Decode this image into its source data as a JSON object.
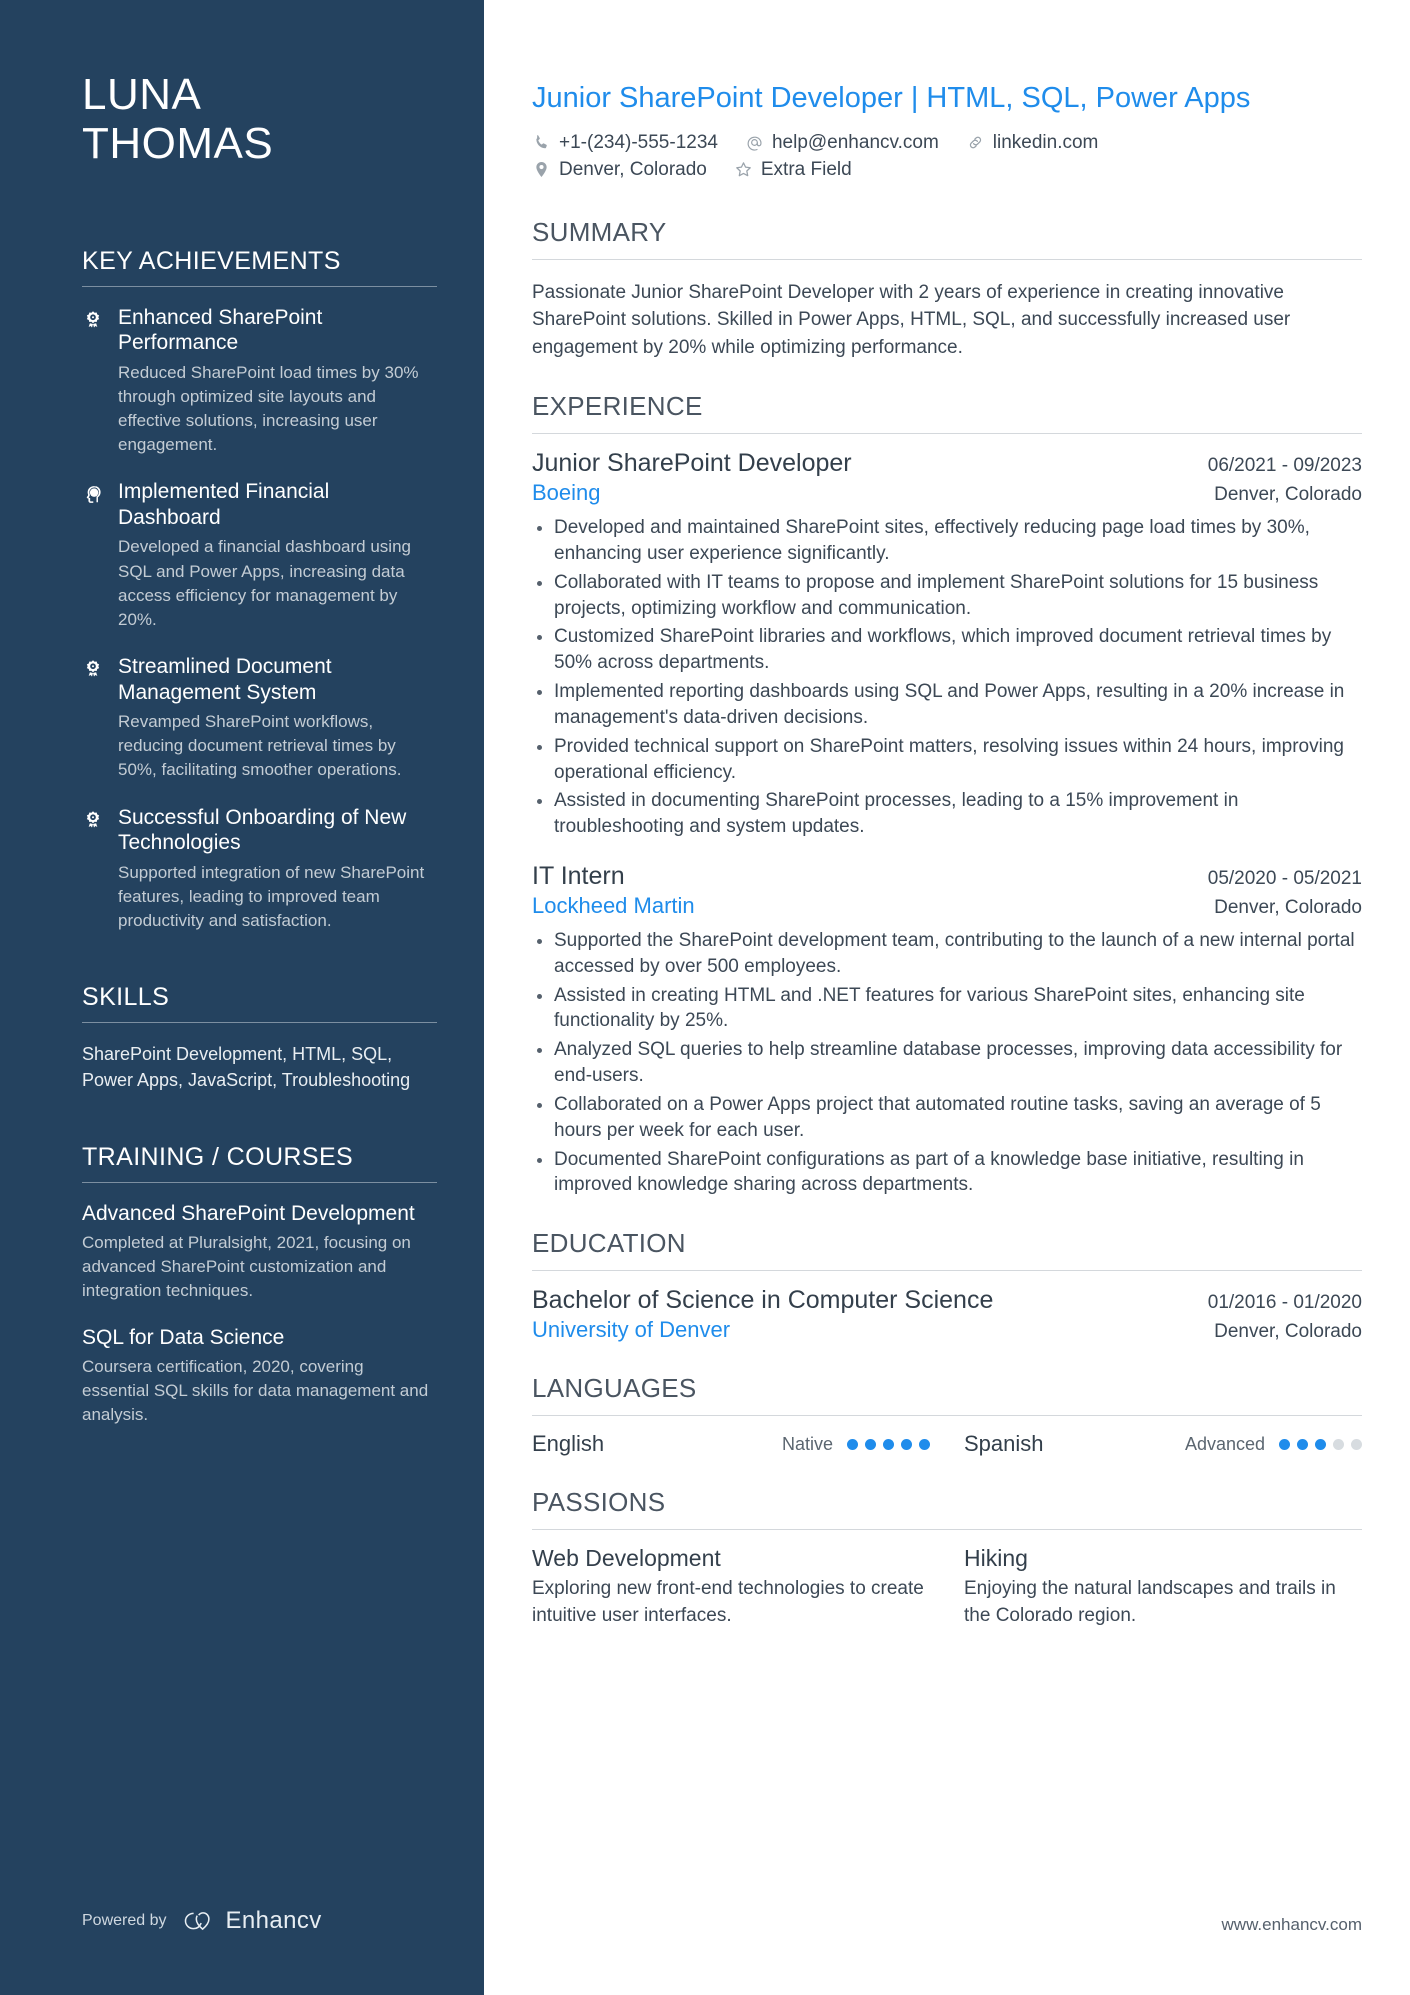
{
  "colors": {
    "sidebar_bg": "#24425f",
    "accent_blue": "#1f8ceb",
    "body_text": "#3c4855"
  },
  "sidebar": {
    "name_first": "LUNA",
    "name_last": "THOMAS",
    "achievements_heading": "KEY ACHIEVEMENTS",
    "achievements": [
      {
        "icon": "award-ribbon-icon",
        "title": "Enhanced SharePoint Performance",
        "desc": "Reduced SharePoint load times by 30% through optimized site layouts and effective solutions, increasing user engagement."
      },
      {
        "icon": "idea-head-icon",
        "title": "Implemented Financial Dashboard",
        "desc": "Developed a financial dashboard using SQL and Power Apps, increasing data access efficiency for management by 20%."
      },
      {
        "icon": "award-ribbon-icon",
        "title": "Streamlined Document Management System",
        "desc": "Revamped SharePoint workflows, reducing document retrieval times by 50%, facilitating smoother operations."
      },
      {
        "icon": "award-ribbon-icon",
        "title": "Successful Onboarding of New Technologies",
        "desc": "Supported integration of new SharePoint features, leading to improved team productivity and satisfaction."
      }
    ],
    "skills_heading": "SKILLS",
    "skills_text": "SharePoint Development, HTML, SQL, Power Apps, JavaScript, Troubleshooting",
    "training_heading": "TRAINING / COURSES",
    "courses": [
      {
        "title": "Advanced SharePoint Development",
        "desc": "Completed at Pluralsight, 2021, focusing on advanced SharePoint customization and integration techniques."
      },
      {
        "title": "SQL for Data Science",
        "desc": "Coursera certification, 2020, covering essential SQL skills for data management and analysis."
      }
    ],
    "powered_by_label": "Powered by",
    "brand_name": "Enhancv"
  },
  "main": {
    "headline": "Junior SharePoint Developer | HTML, SQL, Power Apps",
    "contacts": [
      {
        "icon": "phone-icon",
        "text": "+1-(234)-555-1234"
      },
      {
        "icon": "email-at-icon",
        "text": "help@enhancv.com"
      },
      {
        "icon": "link-icon",
        "text": "linkedin.com"
      }
    ],
    "contacts_row2": [
      {
        "icon": "location-pin-icon",
        "text": "Denver, Colorado"
      },
      {
        "icon": "star-icon",
        "text": "Extra Field"
      }
    ],
    "summary_heading": "SUMMARY",
    "summary_text": "Passionate Junior SharePoint Developer with 2 years of experience in creating innovative SharePoint solutions. Skilled in Power Apps, HTML, SQL, and successfully increased user engagement by 20% while optimizing performance.",
    "experience_heading": "EXPERIENCE",
    "jobs": [
      {
        "title": "Junior SharePoint Developer",
        "dates": "06/2021 - 09/2023",
        "company": "Boeing",
        "location": "Denver, Colorado",
        "bullets": [
          "Developed and maintained SharePoint sites, effectively reducing page load times by 30%, enhancing user experience significantly.",
          "Collaborated with IT teams to propose and implement SharePoint solutions for 15 business projects, optimizing workflow and communication.",
          "Customized SharePoint libraries and workflows, which improved document retrieval times by 50% across departments.",
          "Implemented reporting dashboards using SQL and Power Apps, resulting in a 20% increase in management's data-driven decisions.",
          "Provided technical support on SharePoint matters, resolving issues within 24 hours, improving operational efficiency.",
          "Assisted in documenting SharePoint processes, leading to a 15% improvement in troubleshooting and system updates."
        ]
      },
      {
        "title": "IT Intern",
        "dates": "05/2020 - 05/2021",
        "company": "Lockheed Martin",
        "location": "Denver, Colorado",
        "bullets": [
          "Supported the SharePoint development team, contributing to the launch of a new internal portal accessed by over 500 employees.",
          "Assisted in creating HTML and .NET features for various SharePoint sites, enhancing site functionality by 25%.",
          "Analyzed SQL queries to help streamline database processes, improving data accessibility for end-users.",
          "Collaborated on a Power Apps project that automated routine tasks, saving an average of 5 hours per week for each user.",
          "Documented SharePoint configurations as part of a knowledge base initiative, resulting in improved knowledge sharing across departments."
        ]
      }
    ],
    "education_heading": "EDUCATION",
    "education": [
      {
        "degree": "Bachelor of Science in Computer Science",
        "dates": "01/2016 - 01/2020",
        "school": "University of Denver",
        "location": "Denver, Colorado"
      }
    ],
    "languages_heading": "LANGUAGES",
    "languages": [
      {
        "name": "English",
        "level": "Native",
        "filled": 5,
        "total": 5
      },
      {
        "name": "Spanish",
        "level": "Advanced",
        "filled": 3,
        "total": 5
      }
    ],
    "passions_heading": "PASSIONS",
    "passions": [
      {
        "title": "Web Development",
        "desc": "Exploring new front-end technologies to create intuitive user interfaces."
      },
      {
        "title": "Hiking",
        "desc": "Enjoying the natural landscapes and trails in the Colorado region."
      }
    ],
    "footer_url": "www.enhancv.com"
  }
}
